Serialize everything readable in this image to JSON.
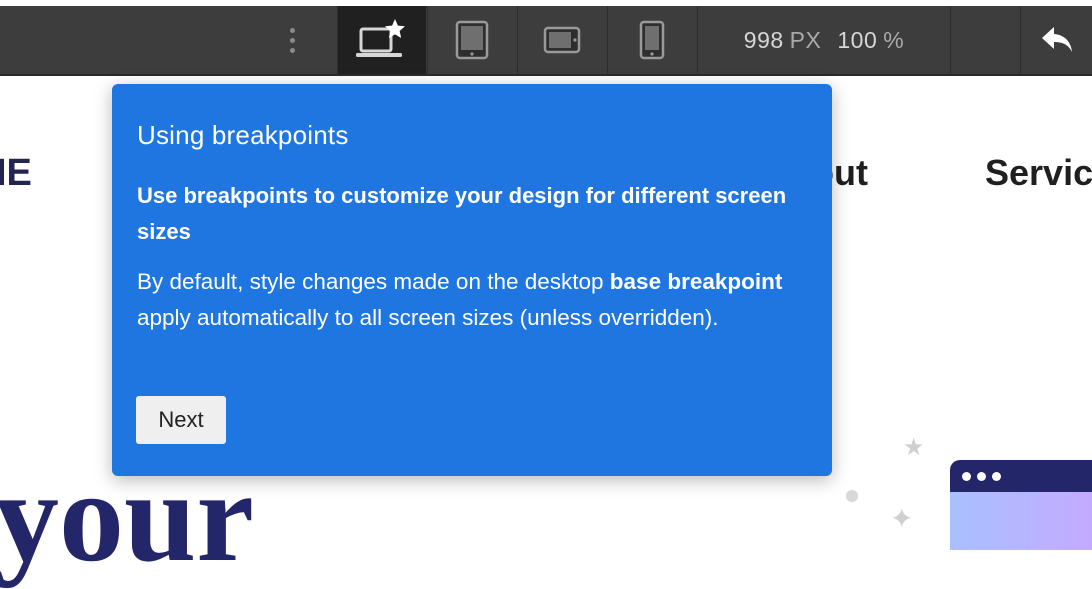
{
  "toolbar": {
    "more_icon": "vertical-ellipsis-icon",
    "breakpoints": [
      {
        "name": "desktop-base",
        "icon": "laptop-star-icon",
        "active": true
      },
      {
        "name": "tablet",
        "icon": "tablet-icon",
        "active": false
      },
      {
        "name": "mobile-landscape",
        "icon": "phone-landscape-icon",
        "active": false
      },
      {
        "name": "mobile-portrait",
        "icon": "phone-portrait-icon",
        "active": false
      }
    ],
    "width_value": "998",
    "width_unit": "PX",
    "zoom_value": "100",
    "zoom_unit": "%",
    "undo_icon": "undo-arrow-icon"
  },
  "background_page": {
    "nav_partial_left": "IE",
    "nav_about_partial": "bout",
    "nav_services_partial": "Servic",
    "hero_partial": "your"
  },
  "popover": {
    "title": "Using breakpoints",
    "subtitle": "Use breakpoints to customize your design for different screen sizes",
    "body_prefix": "By default, style changes made on the desktop ",
    "body_bold": "base breakpoint",
    "body_suffix": " apply automatically to all screen sizes (unless overridden).",
    "next_label": "Next"
  },
  "colors": {
    "popover_bg": "#1f76e0",
    "toolbar_bg": "#3d3d3d",
    "active_tab_bg": "#202020",
    "brand_navy": "#23276a"
  }
}
